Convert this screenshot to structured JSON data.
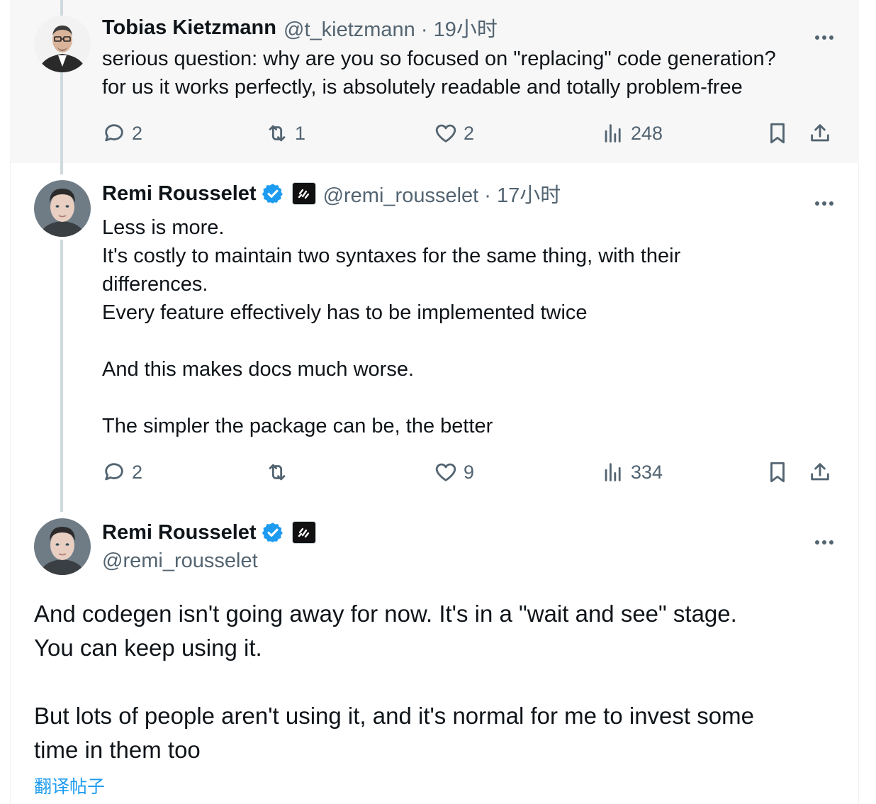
{
  "colors": {
    "accent": "#1d9bf0",
    "text": "#0f1419",
    "muted": "#536471",
    "thread_line": "#cfd9de",
    "highlight_bg": "#f7f7f7"
  },
  "tweets": [
    {
      "display_name": "Tobias Kietzmann",
      "handle_time": "@t_kietzmann · 19小时",
      "body": [
        "serious question: why are you so focused on \"replacing\" code generation?",
        "for us it works perfectly, is absolutely readable and totally problem-free"
      ],
      "stats": {
        "replies": "2",
        "reposts": "1",
        "likes": "2",
        "views": "248"
      }
    },
    {
      "display_name": "Remi Rousselet",
      "handle_time": "@remi_rousselet · 17小时",
      "body": [
        "Less is more.",
        "It's costly to maintain two syntaxes for the same thing, with their",
        "differences.",
        "Every feature effectively has to be implemented twice",
        "",
        "And this makes docs much worse.",
        "",
        "The simpler the package can be, the better"
      ],
      "stats": {
        "replies": "2",
        "reposts": "",
        "likes": "9",
        "views": "334"
      }
    },
    {
      "display_name": "Remi Rousselet",
      "handle": "@remi_rousselet",
      "body": [
        "And codegen isn't going away for now. It's in a \"wait and see\" stage.",
        "You can keep using it.",
        "",
        "But lots of people aren't using it, and it's normal for me to invest some",
        "time in them too"
      ],
      "translate_label": "翻译帖子"
    }
  ]
}
